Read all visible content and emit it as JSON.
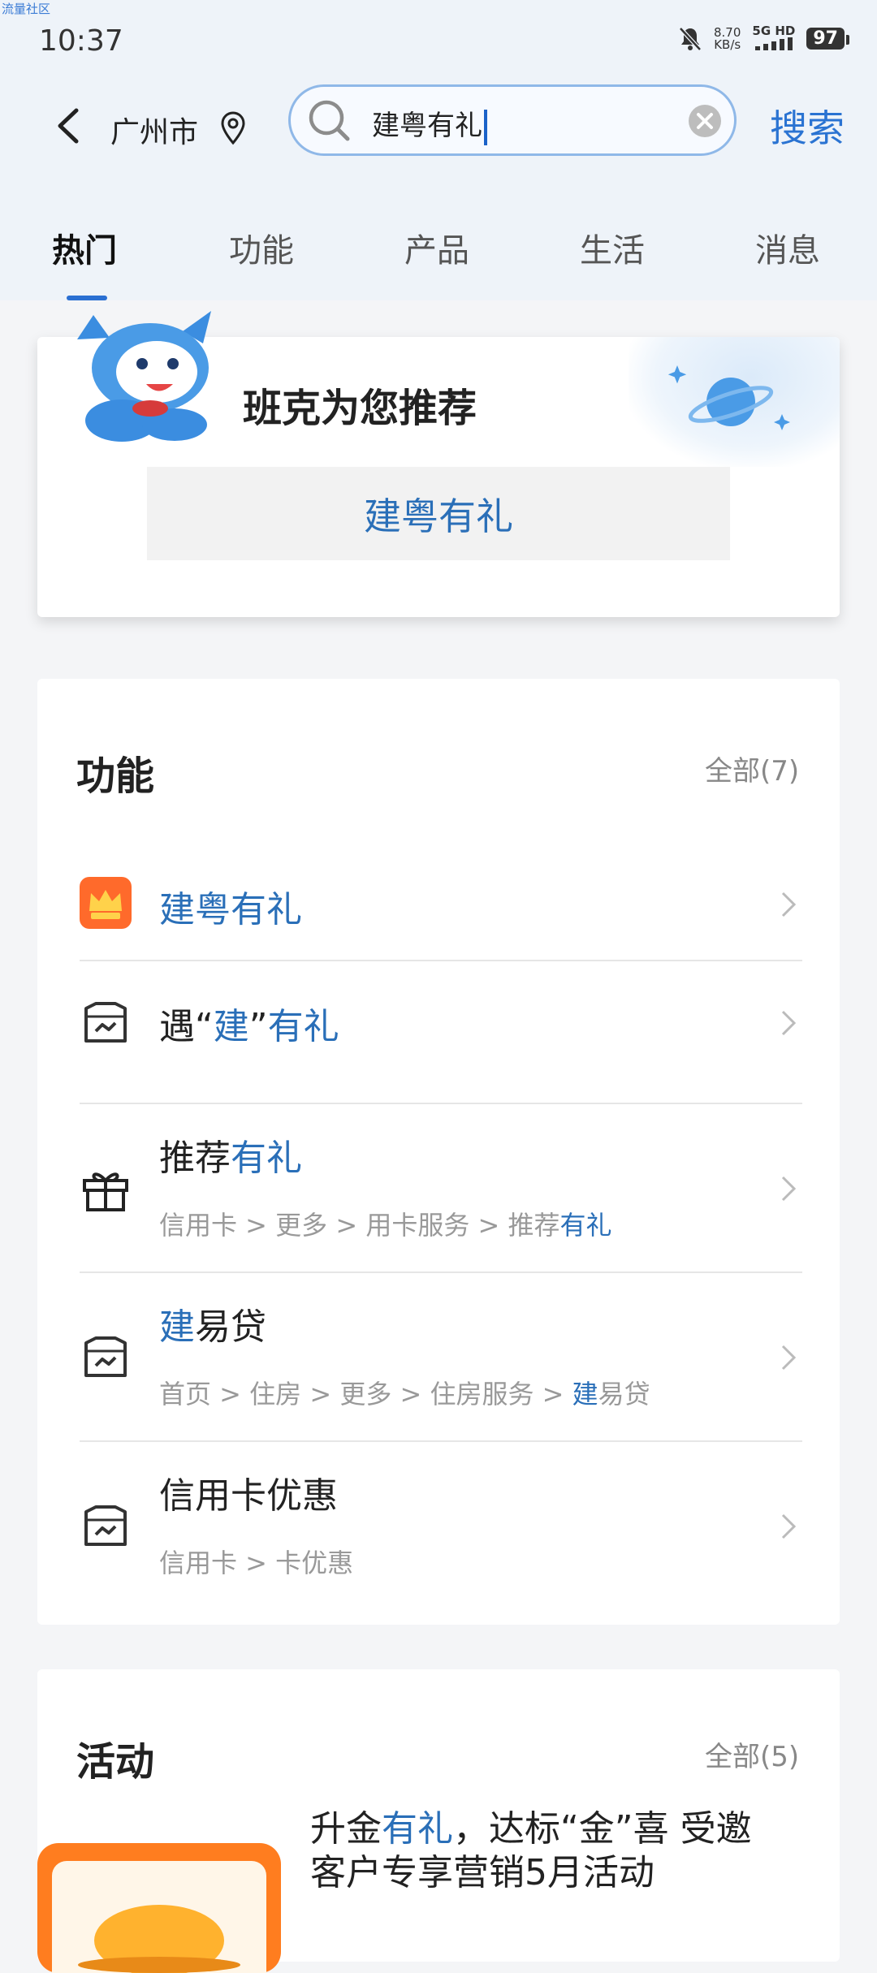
{
  "status_bar": {
    "watermark": "流量社区",
    "time": "10:37",
    "net_speed_value": "8.70",
    "net_speed_unit": "KB/s",
    "signal_top": "5G HD",
    "battery": "97"
  },
  "header": {
    "city": "广州市",
    "search_value": "建粤有礼",
    "search_button": "搜索"
  },
  "tabs": [
    "热门",
    "功能",
    "产品",
    "生活",
    "消息"
  ],
  "recommend": {
    "title": "班克为您推荐",
    "chip": "建粤有礼"
  },
  "functions": {
    "title": "功能",
    "more": "全部(7)",
    "items": [
      {
        "title_pre": "",
        "title_hl": "建粤有礼",
        "title_post": "",
        "path": ""
      },
      {
        "title_pre": "遇“",
        "title_hl": "建",
        "title_mid": "”",
        "title_hl2": "有礼",
        "path": ""
      },
      {
        "title_pre": "推荐",
        "title_hl": "有礼",
        "path_pre": "信用卡  >  更多  >  用卡服务  >  推荐",
        "path_hl": "有礼"
      },
      {
        "title_hl": "建",
        "title_post": "易贷",
        "path_pre": "首页  >  住房  >  更多  >  住房服务  >  ",
        "path_hl": "建",
        "path_post": "易贷"
      },
      {
        "title_pre": "信用卡优惠",
        "path_pre": "信用卡  >  卡优惠"
      }
    ]
  },
  "activities": {
    "title": "活动",
    "more": "全部(5)",
    "item": {
      "line1_pre": "升金",
      "line1_hl": "有礼",
      "line1_post": "，达标“金”喜 受邀",
      "line2": "客户专享营销5月活动"
    }
  },
  "colors": {
    "accent": "#2a6fb8",
    "tab_indicator": "#2a6fd2",
    "icon_orange": "#ff6a2b"
  }
}
